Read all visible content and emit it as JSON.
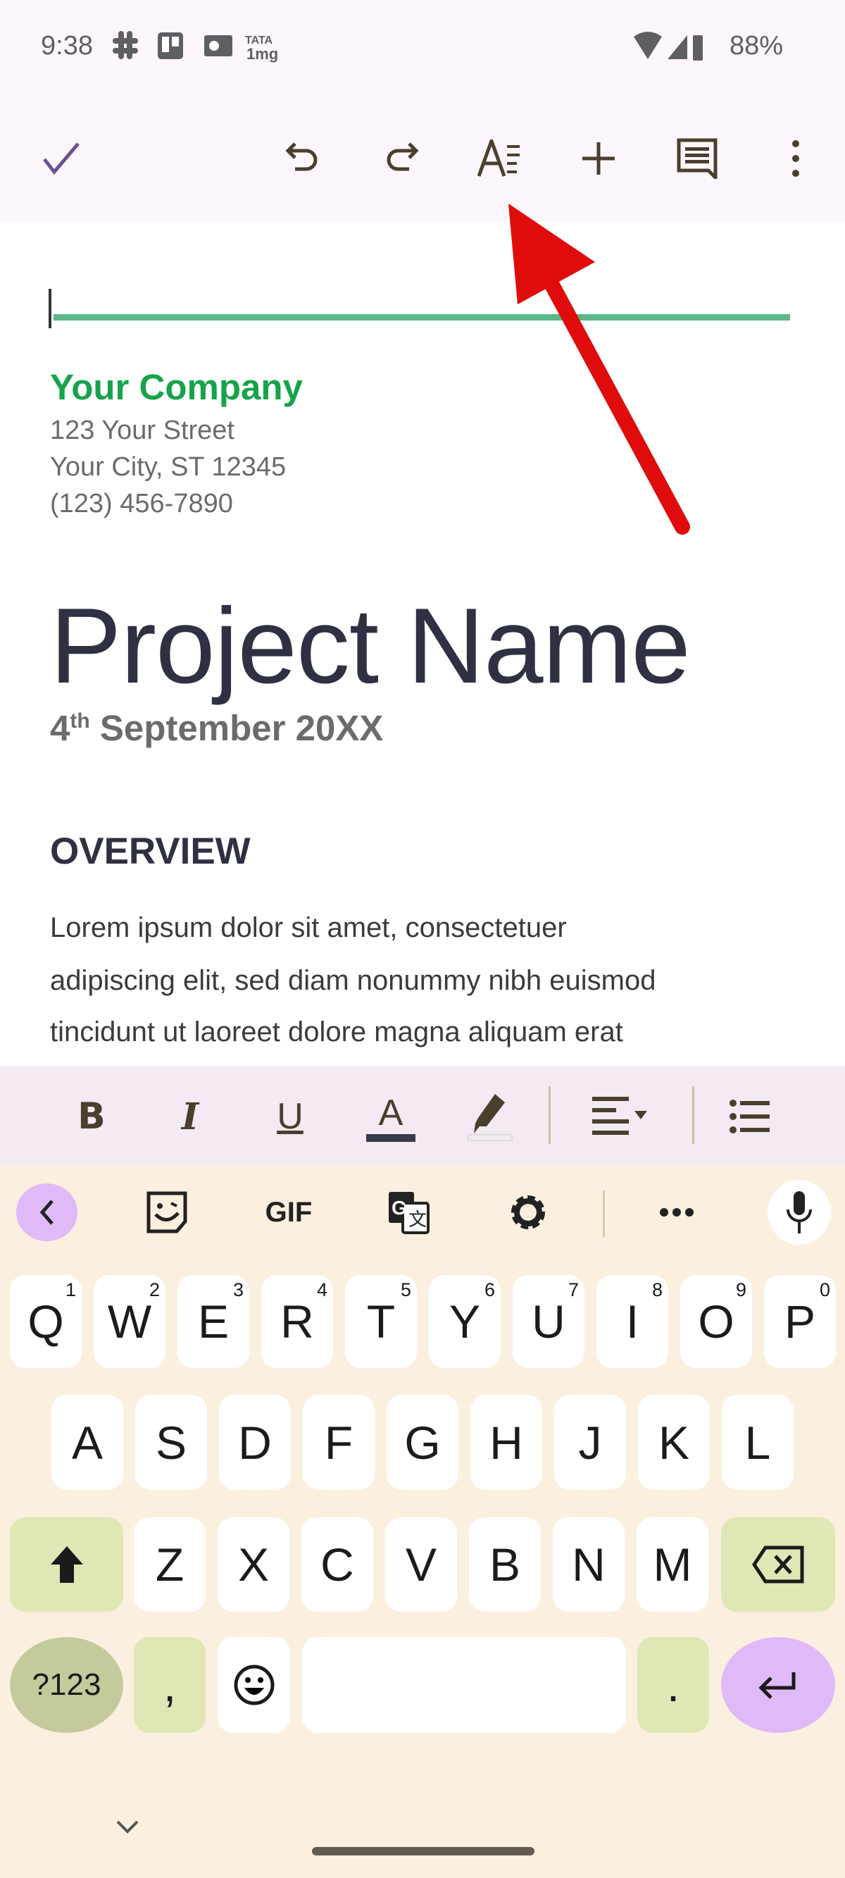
{
  "status_bar": {
    "time": "9:38",
    "battery": "88%",
    "notification_icons": [
      "slack-icon",
      "trello-icon",
      "outlook-icon",
      "tata-1mg-icon"
    ],
    "system_icons": [
      "wifi-icon",
      "signal-icon",
      "battery-icon"
    ]
  },
  "toolbar": {
    "icons": [
      "check-icon",
      "undo-icon",
      "redo-icon",
      "text-format-icon",
      "insert-icon",
      "comment-icon",
      "more-vert-icon"
    ],
    "accent": "#6b4f91"
  },
  "document": {
    "company": "Your Company",
    "address": [
      "123 Your Street",
      "Your City, ST 12345",
      "(123) 456-7890"
    ],
    "title": "Project Name",
    "date_day": "4",
    "date_suffix": "th",
    "date_rest": " September 20XX",
    "section": "OVERVIEW",
    "body_lines": [
      "Lorem ipsum dolor sit amet, consectetuer",
      "adipiscing elit, sed diam nonummy nibh euismod",
      "tincidunt ut laoreet dolore magna aliquam erat"
    ],
    "line_color": "#5cb78b",
    "company_color": "#16a34a"
  },
  "format_bar": {
    "bold": "B",
    "italic": "I",
    "underline": "U",
    "text_color": "A",
    "icons": [
      "highlight-icon",
      "align-left-icon",
      "bullet-list-icon"
    ]
  },
  "keyboard": {
    "suggestion_gif": "GIF",
    "suggestion_icons": [
      "back-chevron-icon",
      "sticker-icon",
      "translate-icon",
      "settings-icon",
      "more-horiz-icon",
      "mic-icon"
    ],
    "row1": [
      "Q",
      "W",
      "E",
      "R",
      "T",
      "Y",
      "U",
      "I",
      "O",
      "P"
    ],
    "row1_hints": [
      "1",
      "2",
      "3",
      "4",
      "5",
      "6",
      "7",
      "8",
      "9",
      "0"
    ],
    "row2": [
      "A",
      "S",
      "D",
      "F",
      "G",
      "H",
      "J",
      "K",
      "L"
    ],
    "row3": [
      "Z",
      "X",
      "C",
      "V",
      "B",
      "N",
      "M"
    ],
    "symbols": "?123",
    "comma": ",",
    "period": "."
  },
  "annotation": {
    "arrow_color": "#e00c0c"
  }
}
